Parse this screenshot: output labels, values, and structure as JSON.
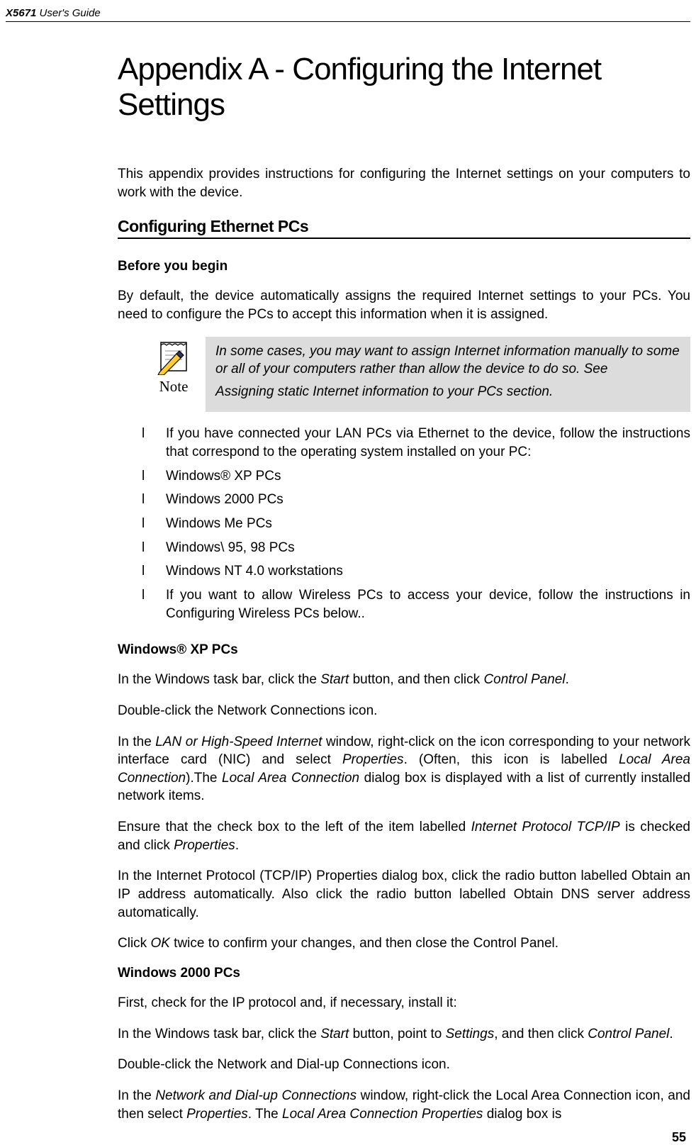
{
  "header": {
    "product": "X5671",
    "guide": " User's Guide"
  },
  "title": "Appendix A - Configuring the Internet Settings",
  "intro": "This appendix provides instructions for configuring the Internet settings on your computers to work with the device.",
  "section_cfg": "Configuring Ethernet PCs",
  "before_begin_h": "Before you begin",
  "before_begin_p": "By default, the device automatically assigns the required Internet settings to your PCs. You need to configure the PCs to accept this information when it is assigned.",
  "note_label": "Note",
  "note_p1": "In some cases, you may want to assign Internet information manually to some or all of your computers rather than allow the device to do so. See",
  "note_p2": "Assigning static Internet information to your PCs section.",
  "bullets": [
    "If you have connected your LAN PCs via Ethernet to the device, follow the instructions that correspond to the operating system installed on your PC:",
    "Windows® XP PCs",
    "Windows 2000 PCs",
    "Windows Me PCs",
    "Windows\\ 95, 98 PCs",
    "Windows NT 4.0 workstations",
    "If you want to allow Wireless PCs to access your device, follow the instructions in Configuring Wireless PCs below.."
  ],
  "bullet_marker": "l",
  "xp_h": "Windows® XP PCs",
  "xp_p1_a": "In the Windows task bar, click the ",
  "xp_p1_i1": "Start",
  "xp_p1_b": " button, and then click ",
  "xp_p1_i2": "Control Panel",
  "xp_p1_c": ".",
  "xp_p2": "Double-click the Network Connections icon.",
  "xp_p3_a": "In the ",
  "xp_p3_i1": "LAN or High-Speed Internet",
  "xp_p3_b": " window, right-click on the icon corresponding to your network interface card (NIC) and select ",
  "xp_p3_i2": "Properties",
  "xp_p3_c": ". (Often, this icon is labelled ",
  "xp_p3_i3": "Local Area Connection",
  "xp_p3_d": ").The ",
  "xp_p3_i4": "Local Area Connection",
  "xp_p3_e": " dialog box is displayed with a list of currently installed network items.",
  "xp_p4_a": "Ensure that the check box to the left of the item labelled ",
  "xp_p4_i1": "Internet Protocol TCP/IP",
  "xp_p4_b": " is checked and click ",
  "xp_p4_i2": "Properties",
  "xp_p4_c": ".",
  "xp_p5": "In the Internet Protocol (TCP/IP) Properties dialog box, click the radio button labelled Obtain an IP address automatically. Also click the radio button labelled Obtain DNS server address automatically.",
  "xp_p6_a": "Click ",
  "xp_p6_i1": "OK",
  "xp_p6_b": " twice to confirm your changes, and then close the Control Panel.",
  "w2k_h": "Windows 2000 PCs",
  "w2k_p1": "First, check for the IP protocol and, if necessary, install it:",
  "w2k_p2_a": "In the Windows task bar, click the ",
  "w2k_p2_i1": "Start",
  "w2k_p2_b": " button, point to ",
  "w2k_p2_i2": "Settings",
  "w2k_p2_c": ", and then click ",
  "w2k_p2_i3": "Control Panel",
  "w2k_p2_d": ".",
  "w2k_p3": "Double-click the Network and Dial-up Connections icon.",
  "w2k_p4_a": "In the ",
  "w2k_p4_i1": "Network and Dial-up Connections",
  "w2k_p4_b": " window, right-click the Local Area Connection icon, and then select ",
  "w2k_p4_i2": "Properties",
  "w2k_p4_c": ". The ",
  "w2k_p4_i3": "Local Area Connection Properties",
  "w2k_p4_d": " dialog box is",
  "page_number": "55"
}
